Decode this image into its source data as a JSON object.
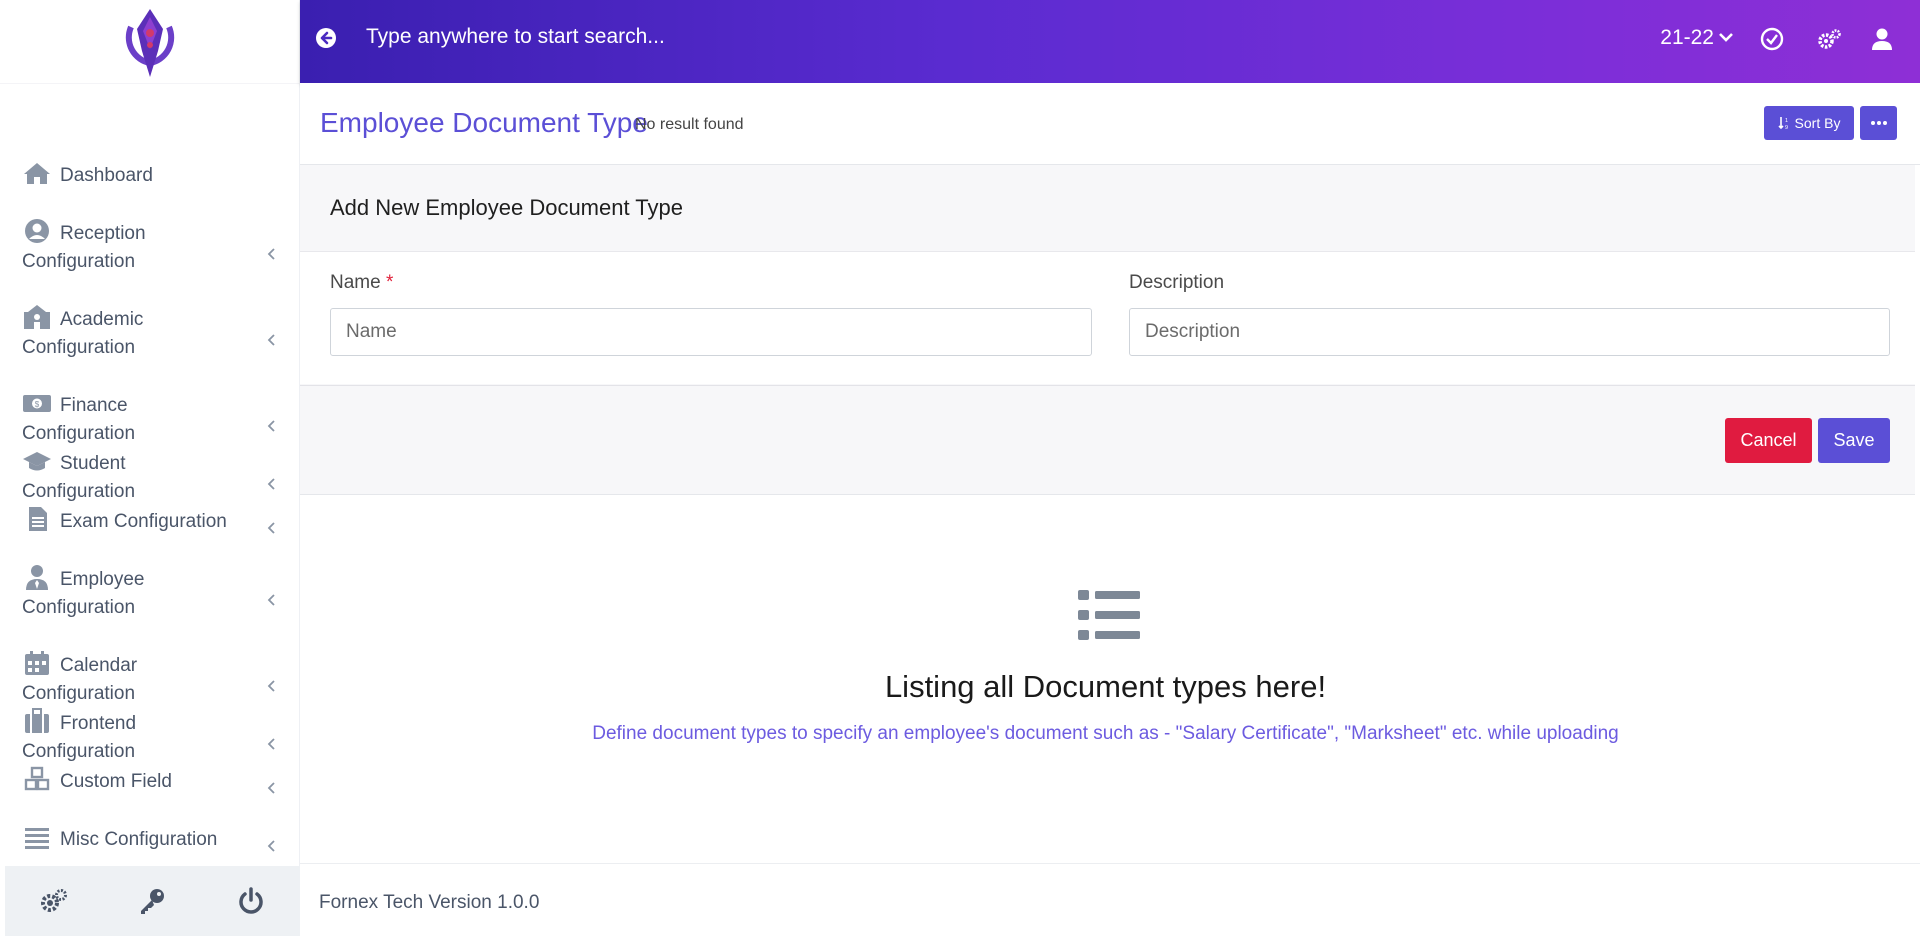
{
  "topbar": {
    "search_placeholder": "Type anywhere to start search...",
    "session": "21-22"
  },
  "sidebar": {
    "items": [
      {
        "label": "Dashboard",
        "icon": "home-icon"
      },
      {
        "label": "Reception Configuration",
        "icon": "user-circle-icon"
      },
      {
        "label": "Academic Configuration",
        "icon": "school-icon"
      },
      {
        "label": "Finance Configuration",
        "icon": "money-icon"
      },
      {
        "label": "Student Configuration",
        "icon": "graduation-cap-icon"
      },
      {
        "label": "Exam Configuration",
        "icon": "file-text-icon"
      },
      {
        "label": "Employee Configuration",
        "icon": "user-tie-icon"
      },
      {
        "label": "Calendar Configuration",
        "icon": "calendar-icon"
      },
      {
        "label": "Frontend Configuration",
        "icon": "suitcase-icon"
      },
      {
        "label": "Custom Field",
        "icon": "cubes-icon"
      },
      {
        "label": "Misc Configuration",
        "icon": "list-icon"
      }
    ]
  },
  "header": {
    "title": "Employee Document Type",
    "subtitle": "No result found",
    "sort_label": "Sort By"
  },
  "form": {
    "title": "Add New Employee Document Type",
    "name_label": "Name",
    "name_required": "*",
    "name_placeholder": "Name",
    "description_label": "Description",
    "description_placeholder": "Description",
    "cancel_label": "Cancel",
    "save_label": "Save"
  },
  "empty_state": {
    "title": "Listing all Document types here!",
    "description": "Define document types to specify an employee's document such as - \"Salary Certificate\", \"Marksheet\" etc. while uploading"
  },
  "footer": {
    "version_text": "Fornex Tech Version 1.0.0"
  },
  "colors": {
    "accent": "#5b4fd6",
    "cancel": "#e01b40",
    "topbar_start": "#3a1fb0",
    "topbar_end": "#8e2fd6"
  }
}
